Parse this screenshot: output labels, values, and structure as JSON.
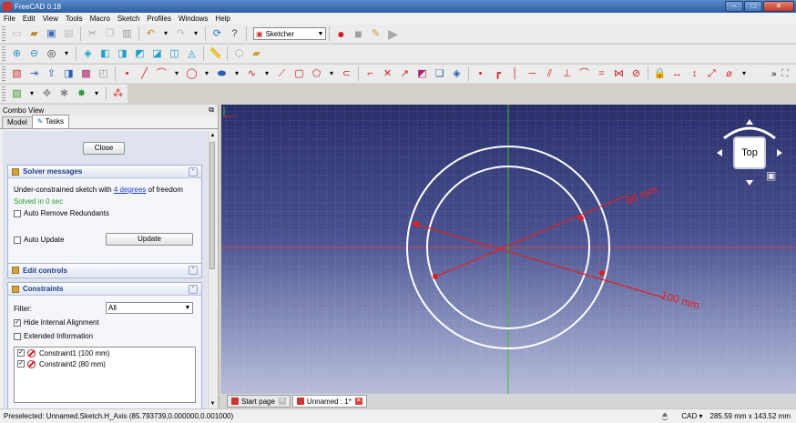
{
  "window": {
    "title": "FreeCAD 0.18"
  },
  "menu": [
    "File",
    "Edit",
    "View",
    "Tools",
    "Macro",
    "Sketch",
    "Profiles",
    "Windows",
    "Help"
  ],
  "toolbar": {
    "workbench": "Sketcher",
    "overflow": "»"
  },
  "combo": {
    "title": "Combo View",
    "tabs": [
      "Model",
      "Tasks"
    ],
    "close_label": "Close",
    "solver": {
      "title": "Solver messages",
      "msg_prefix": "Under-constrained sketch with ",
      "msg_link": "4 degrees",
      "msg_suffix": " of freedom",
      "solved": "Solved in 0 sec",
      "auto_remove": "Auto Remove Redundants",
      "auto_update": "Auto Update",
      "update_label": "Update"
    },
    "edit_controls": {
      "title": "Edit controls"
    },
    "constraints": {
      "title": "Constraints",
      "filter_label": "Filter:",
      "filter_value": "All",
      "hide_internal": "Hide Internal Alignment",
      "extended_info": "Extended Information",
      "items": [
        "Constraint1 (100 mm)",
        "Constraint2 (80 mm)"
      ]
    }
  },
  "view": {
    "navcube_face": "Top",
    "dim_outer": "100 mm",
    "dim_inner": "80 mm",
    "colors": {
      "circle": "#ffffff",
      "dimension": "#e02020",
      "h_axis": "#d04040",
      "v_axis": "#30c030"
    }
  },
  "view_tabs": [
    "Start page",
    "Unnamed : 1*"
  ],
  "status": {
    "text": "Preselected: Unnamed.Sketch.H_Axis (85.793739,0.000000,0.001000)",
    "nav_style": "CAD",
    "dimensions": "285.59 mm x 143.52 mm"
  }
}
